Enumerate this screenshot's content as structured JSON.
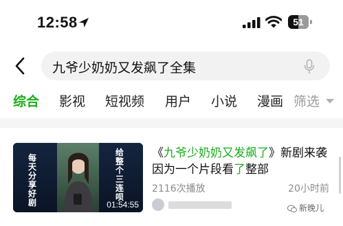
{
  "status_bar": {
    "time": "12:58",
    "battery_level": "51",
    "battery_fraction": 0.51,
    "icons": [
      "location-arrow-icon",
      "cellular-signal-icon",
      "wifi-icon",
      "battery-icon"
    ]
  },
  "search": {
    "query": "九爷少奶奶又发飙了全集",
    "icons": [
      "back-chevron-icon",
      "microphone-icon"
    ]
  },
  "tabs": [
    {
      "label": "综合",
      "active": true
    },
    {
      "label": "影视",
      "active": false
    },
    {
      "label": "短视频",
      "active": false
    },
    {
      "label": "用户",
      "active": false
    },
    {
      "label": "小说",
      "active": false
    },
    {
      "label": "漫画",
      "active": false
    },
    {
      "label": "筛选",
      "active": false
    }
  ],
  "result": {
    "title_open": "《",
    "title_highlight": "九爷少奶奶又发飙了",
    "title_close": "》",
    "title_mid": "新剧来袭因为一个片段看",
    "title_highlight2": "了",
    "title_end": "整部",
    "play_count": "2116次播放",
    "time_ago": "20小时前",
    "thumbnail": {
      "left_caption": "每天分享好剧",
      "right_caption": "给整个三连呗",
      "duration": "01:54:55"
    }
  },
  "watermark": {
    "text": "新晚儿"
  },
  "colors": {
    "accent": "#1aad19",
    "muted": "#8a8a8a",
    "search_bg": "#f2f2f2"
  }
}
